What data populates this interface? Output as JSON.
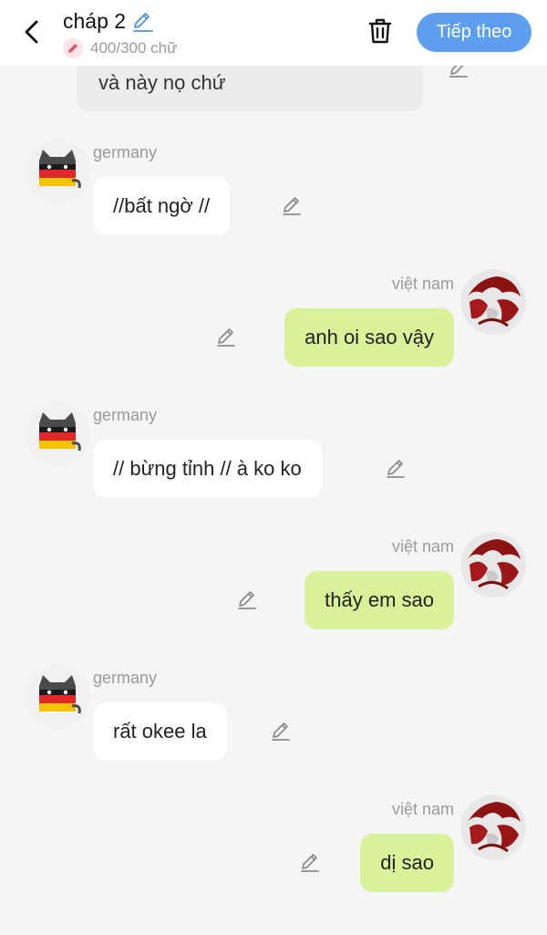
{
  "header": {
    "title": "cháp 2",
    "word_count": "400/300 chữ",
    "next_label": "Tiếp theo"
  },
  "colors": {
    "accent": "#5e9eee",
    "bubble_right": "#d9f29a",
    "bubble_left": "#ffffff",
    "badge_bg": "#fde3e6",
    "badge_pen": "#e2506a"
  },
  "messages": [
    {
      "side": "left",
      "sender": "",
      "text": "và này nọ chứ"
    },
    {
      "side": "left",
      "sender": "germany",
      "text": "//bất ngờ //"
    },
    {
      "side": "right",
      "sender": "việt nam",
      "text": "anh oi sao vậy"
    },
    {
      "side": "left",
      "sender": "germany",
      "text": "// bừng tỉnh // à ko ko"
    },
    {
      "side": "right",
      "sender": "việt nam",
      "text": "thấy em sao"
    },
    {
      "side": "left",
      "sender": "germany",
      "text": "rất okee la"
    },
    {
      "side": "right",
      "sender": "việt nam",
      "text": "dị sao"
    }
  ]
}
